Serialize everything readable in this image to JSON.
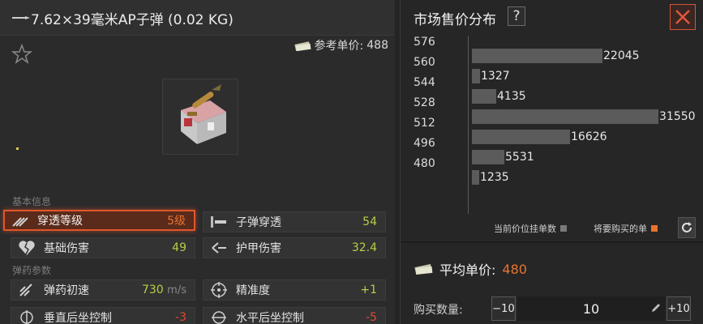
{
  "item": {
    "title": "7.62×39毫米AP子弹 (0.02 KG)",
    "ref_price_label": "参考单价:",
    "ref_price_value": "488"
  },
  "sections": {
    "basic": "基本信息",
    "ammo": "弹药参数"
  },
  "stats": [
    {
      "name": "穿透等级",
      "value": "5级",
      "color": "orange",
      "icon": "penetration-icon",
      "highlighted": true
    },
    {
      "name": "子弹穿透",
      "value": "54",
      "color": "green",
      "icon": "bullet-pierce-icon"
    },
    {
      "name": "基础伤害",
      "value": "49",
      "color": "green",
      "icon": "broken-heart-icon"
    },
    {
      "name": "护甲伤害",
      "value": "32.4",
      "color": "green",
      "icon": "armor-damage-icon"
    },
    {
      "name": "弹药初速",
      "value": "730",
      "unit": "m/s",
      "color": "green",
      "icon": "velocity-icon"
    },
    {
      "name": "精准度",
      "value": "+1",
      "color": "green",
      "icon": "crosshair-icon"
    },
    {
      "name": "垂直后坐控制",
      "value": "-3",
      "color": "red",
      "icon": "vertical-recoil-icon"
    },
    {
      "name": "水平后坐控制",
      "value": "-5",
      "color": "red",
      "icon": "horizontal-recoil-icon"
    }
  ],
  "market": {
    "title": "市场售价分布",
    "help": "?",
    "legend_current": "当前价位挂单数",
    "legend_buy": "将要购买的单",
    "avg_label": "平均单价:",
    "avg_value": "480",
    "qty_label": "购买数量:",
    "qty_minus": "−10",
    "qty_value": "10",
    "qty_plus": "+10"
  },
  "colors": {
    "accent": "#e8742f",
    "positive": "#b6cf45",
    "negative": "#e0492f",
    "bar": "#5b5b5b"
  },
  "chart_data": {
    "type": "bar",
    "orientation": "horizontal",
    "categories": [
      "576",
      "560",
      "544",
      "528",
      "512",
      "496",
      "480"
    ],
    "values": [
      0,
      22045,
      1327,
      4135,
      31550,
      16626,
      5531,
      1235
    ],
    "bars": [
      {
        "label": "",
        "value": 22045,
        "display": "22045"
      },
      {
        "label": "",
        "value": 1327,
        "display": "1327"
      },
      {
        "label": "",
        "value": 4135,
        "display": "4135"
      },
      {
        "label": "",
        "value": 31550,
        "display": "31550"
      },
      {
        "label": "",
        "value": 16626,
        "display": "16626"
      },
      {
        "label": "",
        "value": 5531,
        "display": "5531"
      },
      {
        "label": "",
        "value": 1235,
        "display": "1235"
      }
    ],
    "ylabels": [
      "576",
      "560",
      "544",
      "528",
      "512",
      "496",
      "480"
    ]
  }
}
